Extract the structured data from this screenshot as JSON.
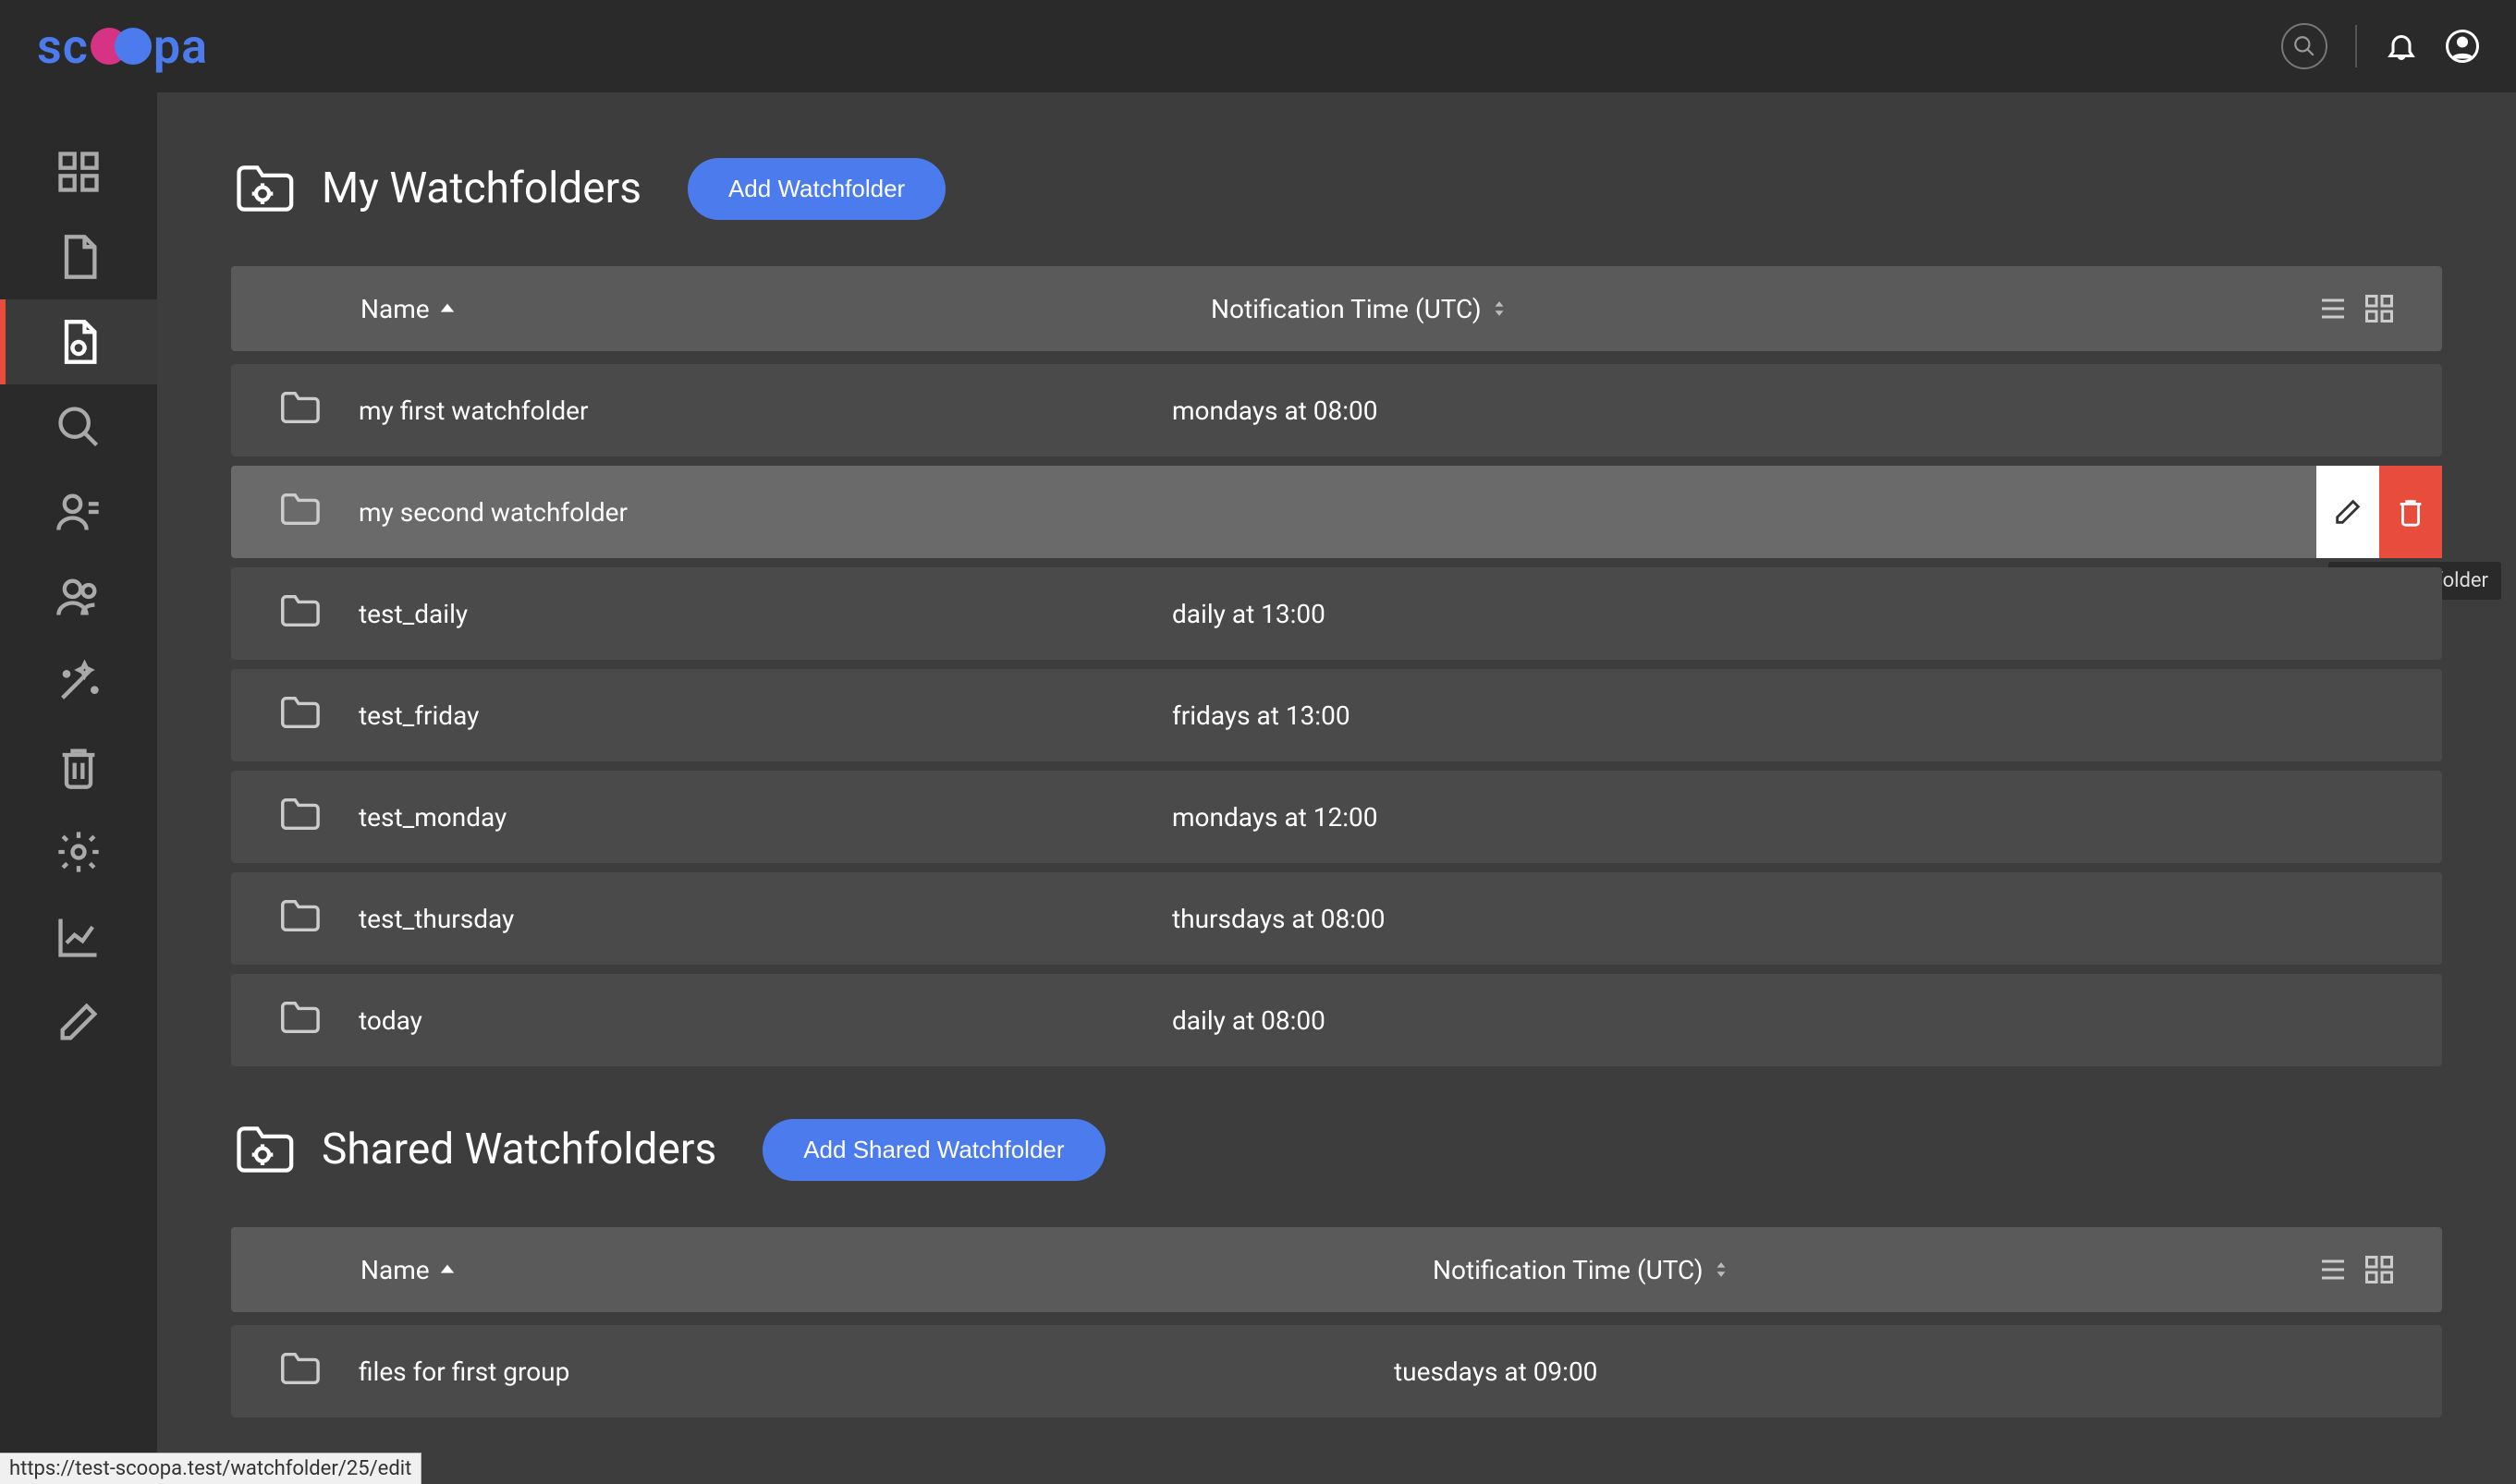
{
  "topbar": {
    "logo_sc": "sc",
    "logo_pa": "pa"
  },
  "sections": {
    "my": {
      "title": "My Watchfolders",
      "add_button": "Add Watchfolder",
      "columns": {
        "name": "Name",
        "time": "Notification Time (UTC)"
      },
      "rows": [
        {
          "name": "my first watchfolder",
          "time": "mondays at 08:00"
        },
        {
          "name": "my second watchfolder",
          "time": ""
        },
        {
          "name": "test_daily",
          "time": "daily at 13:00"
        },
        {
          "name": "test_friday",
          "time": "fridays at 13:00"
        },
        {
          "name": "test_monday",
          "time": "mondays at 12:00"
        },
        {
          "name": "test_thursday",
          "time": "thursdays at 08:00"
        },
        {
          "name": "today",
          "time": "daily at 08:00"
        }
      ]
    },
    "shared": {
      "title": "Shared Watchfolders",
      "add_button": "Add Shared Watchfolder",
      "columns": {
        "name": "Name",
        "time": "Notification Time (UTC)"
      },
      "rows": [
        {
          "name": "files for first group",
          "time": "tuesdays at 09:00"
        }
      ]
    }
  },
  "tooltip": "Edit watchfolder",
  "status_url": "https://test-scoopa.test/watchfolder/25/edit"
}
